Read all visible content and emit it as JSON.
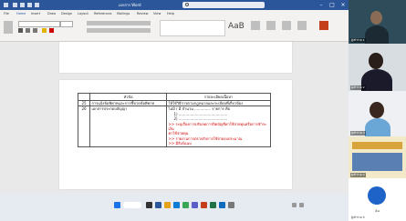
{
  "title_bar": {
    "title": "เอกสาร Word"
  },
  "menu": {
    "items": [
      "File",
      "Home",
      "Insert",
      "Draw",
      "Design",
      "Layout",
      "References",
      "Mailings",
      "Review",
      "View",
      "Help"
    ]
  },
  "ribbon": {
    "styles_glyph": "AaB"
  },
  "document": {
    "table": {
      "headers": [
        "หัวข้อ",
        "รายละเอียดเนื้อหา"
      ],
      "rows": [
        {
          "no": "25",
          "topic": "การแจ้งข้อพิพาทและการชี้ขาดข้อพิพาท",
          "lines": [
            {
              "text": "ให้ใช้วิธีการตามกฎหมายและระเบียบที่เกี่ยวข้อง",
              "red": false
            }
          ]
        },
        {
          "no": "26",
          "topic": "เอกสารประกอบสัญญา",
          "lines": [
            {
              "text": "ไม่มี / มี จำนวน .............. รายการ คือ",
              "red": false
            },
            {
              "text": "1) ..........................................",
              "red": false
            },
            {
              "text": "2) ..........................................",
              "red": false
            },
            {
              "text": ">> ระบุเรื่องการปรับลดการปิดบัญชีค่าใช้จ่ายทุนหรือการชำระเงิน",
              "red": true
            },
            {
              "text": "ค่าใช้จ่ายทุน",
              "red": true
            },
            {
              "text": ">> รายงานการตรวจรับการใช้จ่ายงบประมาณ",
              "red": true
            },
            {
              "text": ">> มีลิงก์แนบ",
              "red": true
            }
          ]
        }
      ]
    }
  },
  "participants": [
    {
      "name": "ผู้เข้าร่วม 1"
    },
    {
      "name": "ผู้เข้าร่วม 2"
    },
    {
      "name": "ผู้เข้าร่วม 3"
    },
    {
      "name": "ผู้เข้าร่วม 4"
    },
    {
      "name": "ผู้เข้าร่วม 5"
    }
  ],
  "self": {
    "label": "ฉัน"
  },
  "colors": {
    "word_blue": "#2b579a",
    "red_text": "#d00000"
  }
}
